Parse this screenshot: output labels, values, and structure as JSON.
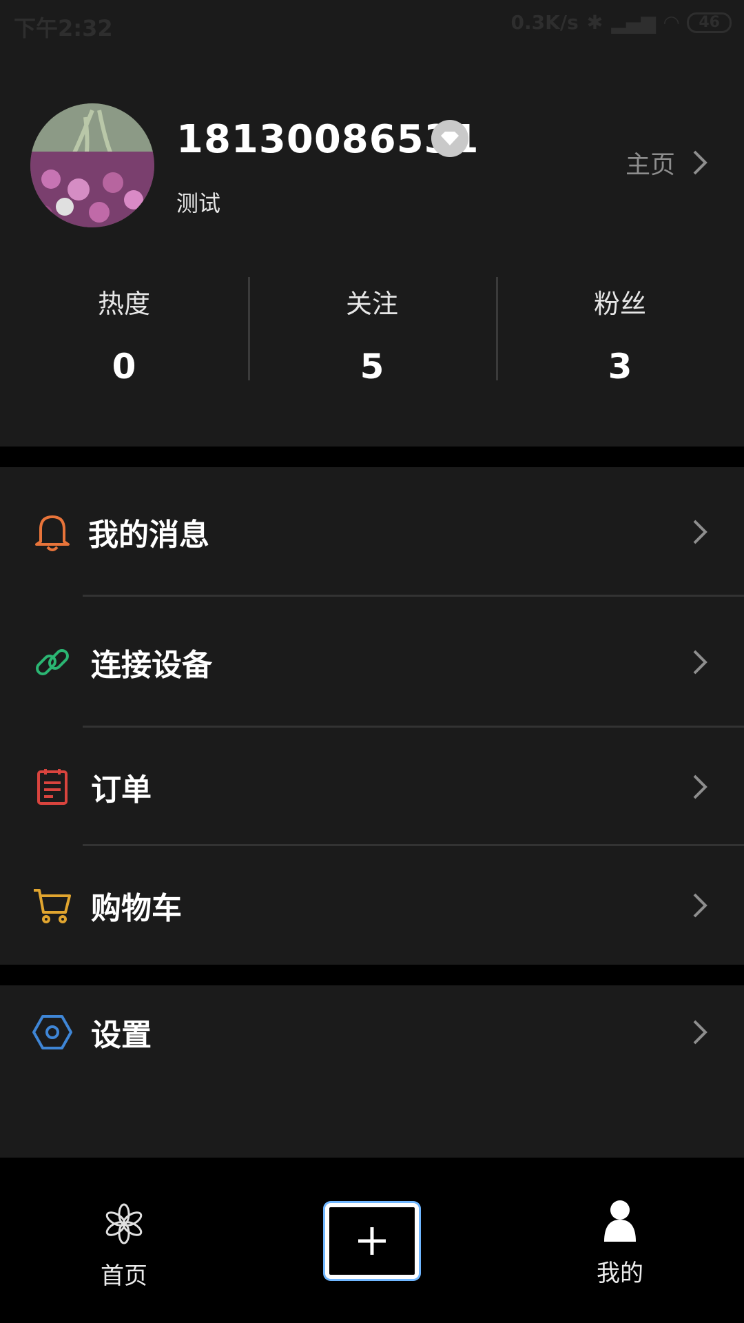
{
  "status_bar": {
    "time": "下午2:32",
    "network_speed": "0.3K/s",
    "battery": "46"
  },
  "profile": {
    "username": "18130086531",
    "bio": "测试",
    "homepage_label": "主页",
    "stats": [
      {
        "label": "热度",
        "value": "0"
      },
      {
        "label": "关注",
        "value": "5"
      },
      {
        "label": "粉丝",
        "value": "3"
      }
    ]
  },
  "menu": {
    "items": [
      {
        "label": "我的消息",
        "icon": "bell-icon",
        "color": "#e8743a"
      },
      {
        "label": "连接设备",
        "icon": "link-icon",
        "color": "#2bb673"
      },
      {
        "label": "订单",
        "icon": "order-icon",
        "color": "#d9443e"
      },
      {
        "label": "购物车",
        "icon": "cart-icon",
        "color": "#e1a52f"
      }
    ],
    "settings": {
      "label": "设置",
      "icon": "settings-icon",
      "color": "#3f86d6"
    }
  },
  "bottom_nav": {
    "home_label": "首页",
    "add_icon": "plus-icon",
    "mine_label": "我的"
  }
}
